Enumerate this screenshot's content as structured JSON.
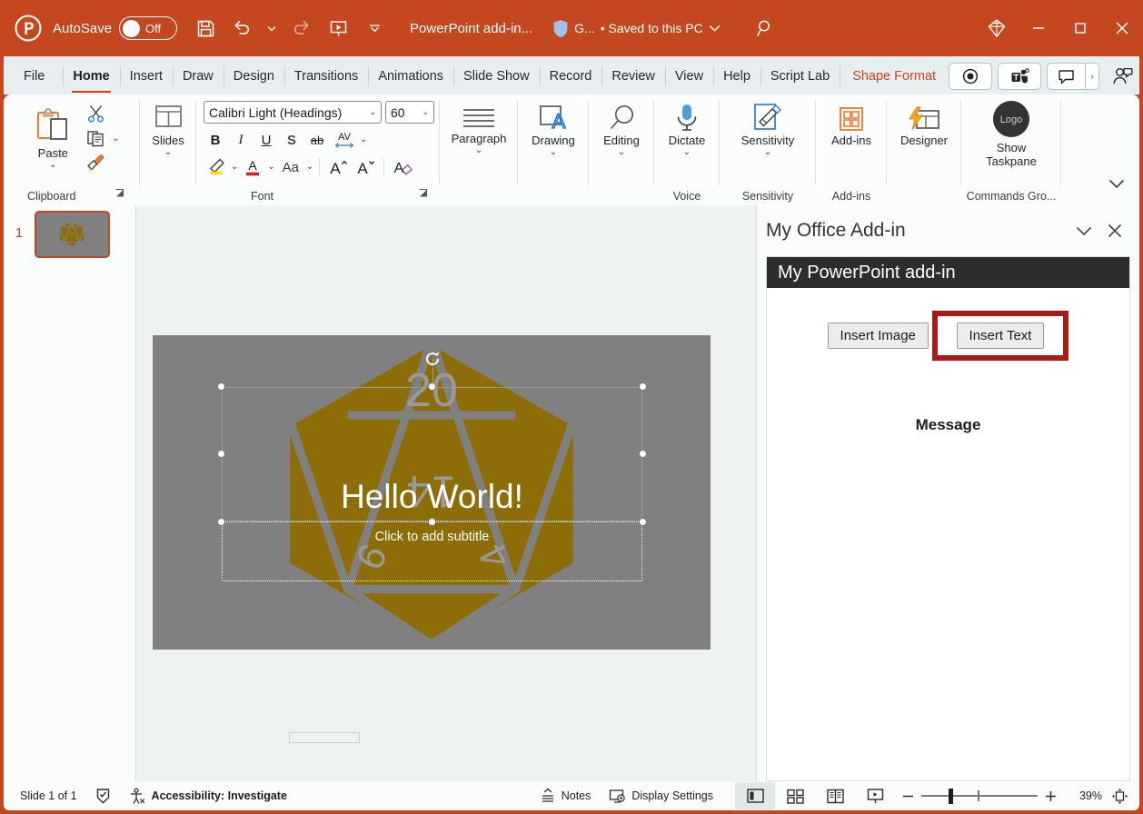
{
  "titlebar": {
    "app_icon": "powerpoint-logo-icon",
    "autosave_label": "AutoSave",
    "autosave_state": "Off",
    "save_icon": "save-icon",
    "undo_icon": "undo-icon",
    "redo_icon": "redo-icon",
    "present_icon": "start-presentation-icon",
    "customize_qat_icon": "chevron-down-icon",
    "document_title": "PowerPoint add-in...",
    "shield_icon": "shield-icon",
    "account_short": "G...",
    "save_status": "• Saved to this PC",
    "save_status_chevron": "chevron-down-icon",
    "search_icon": "search-icon",
    "diamond_icon": "diamond-icon",
    "minimize_icon": "minimize-icon",
    "maximize_icon": "maximize-icon",
    "close_icon": "close-icon"
  },
  "tabs": [
    {
      "label": "File",
      "active": false
    },
    {
      "label": "Home",
      "active": true
    },
    {
      "label": "Insert",
      "active": false
    },
    {
      "label": "Draw",
      "active": false
    },
    {
      "label": "Design",
      "active": false
    },
    {
      "label": "Transitions",
      "active": false
    },
    {
      "label": "Animations",
      "active": false
    },
    {
      "label": "Slide Show",
      "active": false
    },
    {
      "label": "Record",
      "active": false
    },
    {
      "label": "Review",
      "active": false
    },
    {
      "label": "View",
      "active": false
    },
    {
      "label": "Help",
      "active": false
    },
    {
      "label": "Script Lab",
      "active": false
    },
    {
      "label": "Shape Format",
      "active": false
    }
  ],
  "tabbar_right": {
    "record_icon": "record-button-icon",
    "teams_icon": "teams-icon",
    "comments_icon": "comments-icon",
    "comments_chevron": "chevron-right-icon",
    "share_icon": "share-person-icon"
  },
  "ribbon": {
    "clipboard": {
      "paste_label": "Paste",
      "paste_icon": "paste-icon",
      "cut_icon": "scissors-icon",
      "copy_icon": "copy-icon",
      "copy_chevron": "chevron-down-icon",
      "format_painter_icon": "format-painter-icon",
      "group_label": "Clipboard",
      "launcher_icon": "dialog-launcher-icon"
    },
    "slides": {
      "label": "Slides",
      "icon": "new-slide-icon",
      "chevron": "chevron-down-icon"
    },
    "font": {
      "font_name": "Calibri Light (Headings)",
      "font_size": "60",
      "bold": "B",
      "italic": "I",
      "underline": "U",
      "shadow": "S",
      "strikethrough": "ab",
      "char_spacing": "AV",
      "highlight_icon": "text-highlight-icon",
      "font_color_icon": "font-color-icon",
      "change_case": "Aa",
      "increase_size_icon": "increase-font-size-icon",
      "decrease_size_icon": "decrease-font-size-icon",
      "clear_format_icon": "clear-formatting-icon",
      "group_label": "Font",
      "launcher_icon": "dialog-launcher-icon"
    },
    "paragraph": {
      "label": "Paragraph",
      "icon": "paragraph-icon",
      "chevron": "chevron-down-icon"
    },
    "drawing": {
      "label": "Drawing",
      "icon": "drawing-icon",
      "chevron": "chevron-down-icon"
    },
    "editing": {
      "label": "Editing",
      "icon": "editing-magnifier-icon",
      "chevron": "chevron-down-icon"
    },
    "voice": {
      "label": "Dictate",
      "icon": "microphone-icon",
      "chevron": "chevron-down-icon",
      "group_label": "Voice"
    },
    "sensitivity": {
      "label": "Sensitivity",
      "icon": "sensitivity-icon",
      "chevron": "chevron-down-icon",
      "group_label": "Sensitivity"
    },
    "addins": {
      "label": "Add-ins",
      "icon": "add-ins-icon",
      "group_label": "Add-ins"
    },
    "designer": {
      "label": "Designer",
      "icon": "designer-icon"
    },
    "commands": {
      "label_line1": "Show",
      "label_line2": "Taskpane",
      "icon": "logo-badge-icon",
      "logo_text": "Logo",
      "group_label": "Commands Gro..."
    },
    "collapse_icon": "chevron-down-icon"
  },
  "slides_panel": {
    "thumbnail_number": "1"
  },
  "slide": {
    "title_text": "Hello World!",
    "subtitle_placeholder": "Click to add subtitle",
    "background_color": "#808080",
    "image_color": "#8c6d07",
    "die_face_number": "20",
    "rotate_handle_icon": "rotate-handle-icon"
  },
  "taskpane": {
    "title": "My Office Add-in",
    "collapse_icon": "chevron-down-icon",
    "close_icon": "close-icon",
    "addin_header": "My PowerPoint add-in",
    "buttons": [
      {
        "label": "Insert Image",
        "highlighted": false
      },
      {
        "label": "Insert Text",
        "highlighted": true
      }
    ],
    "message_heading": "Message",
    "highlight_color": "#a81919"
  },
  "statusbar": {
    "slide_count": "Slide 1 of 1",
    "language_icon": "spellcheck-icon",
    "accessibility_icon": "accessibility-icon",
    "accessibility_text": "Accessibility: Investigate",
    "notes_label": "Notes",
    "notes_icon": "notes-icon",
    "display_settings_label": "Display Settings",
    "display_settings_icon": "display-settings-icon",
    "views": [
      {
        "name": "normal-view-icon",
        "active": true
      },
      {
        "name": "slide-sorter-view-icon",
        "active": false
      },
      {
        "name": "reading-view-icon",
        "active": false
      },
      {
        "name": "slide-show-view-icon",
        "active": false
      }
    ],
    "zoom_out_icon": "zoom-out-icon",
    "zoom_in_icon": "zoom-in-icon",
    "zoom_level": "39%",
    "fit_slide_icon": "fit-slide-icon"
  }
}
